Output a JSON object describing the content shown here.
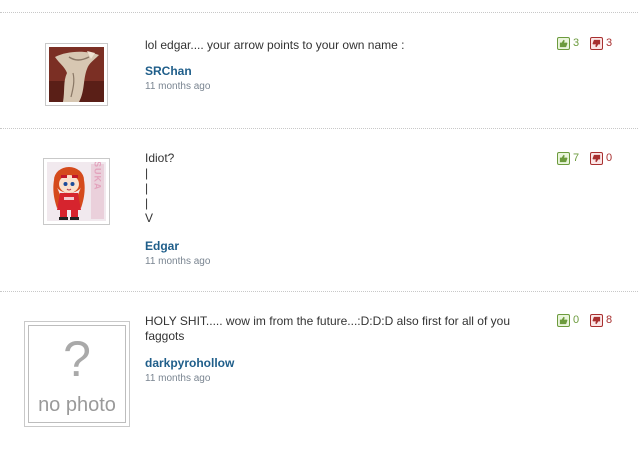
{
  "comments": [
    {
      "text_lines": [
        "lol edgar.... your arrow points to your own name :"
      ],
      "author": "SRChan",
      "time": "11 months ago",
      "likes": "3",
      "dislikes": "3",
      "avatar": "srchan-avatar"
    },
    {
      "text_lines": [
        "Idiot?",
        "|",
        "|",
        "|",
        "V"
      ],
      "author": "Edgar",
      "time": "11 months ago",
      "likes": "7",
      "dislikes": "0",
      "avatar": "asuka-avatar",
      "avatar_text": "ASUKA"
    },
    {
      "text_lines": [
        "HOLY SHIT..... wow im from the future...:D:D:D also first for all of you",
        "faggots"
      ],
      "author": "darkpyrohollow",
      "time": "11 months ago",
      "likes": "0",
      "dislikes": "8",
      "avatar": "no-photo-avatar",
      "avatar_text": "no photo",
      "avatar_glyph": "?"
    }
  ],
  "icons": {
    "like": "thumbs-up-icon",
    "dislike": "thumbs-down-icon"
  },
  "colors": {
    "author": "#1f5e8a",
    "like": "#6c9b3d",
    "dislike": "#a83030",
    "time": "#7a8591"
  }
}
